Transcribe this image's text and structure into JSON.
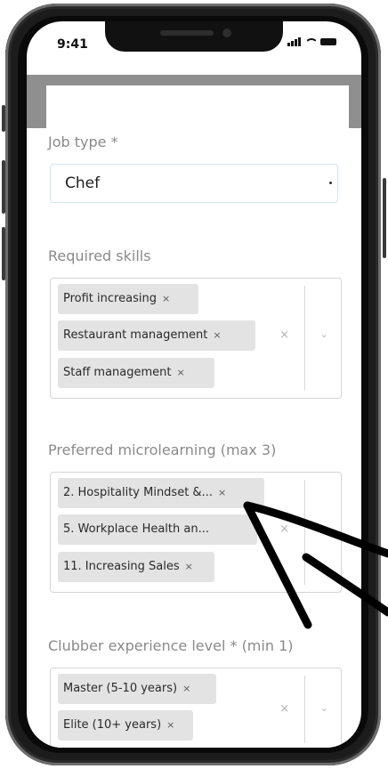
{
  "status_bar": {
    "time": "9:41"
  },
  "form": {
    "job_type": {
      "label": "Job type *",
      "value": "Chef"
    },
    "required_skills": {
      "label": "Required skills",
      "chips": [
        "Profit increasing",
        "Restaurant management",
        "Staff management"
      ],
      "clear_glyph": "×",
      "chevron_glyph": "⌄"
    },
    "microlearning": {
      "label": "Preferred microlearning (max 3)",
      "chips": [
        "2. Hospitality Mindset &...",
        "5. Workplace Health an...",
        "11. Increasing Sales"
      ],
      "clear_glyph": "×",
      "chevron_glyph": "⌄"
    },
    "experience": {
      "label": "Clubber experience level * (min 1)",
      "chips": [
        "Master (5-10 years)",
        "Elite (10+ years)"
      ],
      "clear_glyph": "×",
      "chevron_glyph": "⌄"
    },
    "chip_remove_glyph": "×"
  }
}
